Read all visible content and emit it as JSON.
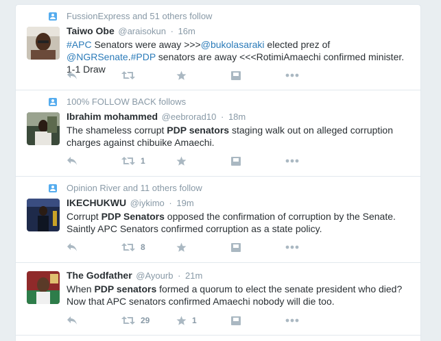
{
  "tweets": [
    {
      "context": "FussionExpress and 51 others follow",
      "fullname": "Taiwo Obe",
      "username": "@araisokun",
      "time": "16m",
      "text_parts": [
        {
          "t": "#APC",
          "k": "hash"
        },
        {
          "t": " Senators were away >>>",
          "k": "plain"
        },
        {
          "t": "@bukolasaraki",
          "k": "link"
        },
        {
          "t": " elected prez of ",
          "k": "plain"
        },
        {
          "t": "@NGRSenate",
          "k": "link"
        },
        {
          "t": ".",
          "k": "plain"
        },
        {
          "t": "#PDP",
          "k": "hash"
        },
        {
          "t": " senators are away <<<RotimiAmaechi confirmed minister. 1-1 Draw",
          "k": "plain"
        }
      ],
      "retweets": "",
      "favorites": ""
    },
    {
      "context": "100% FOLLOW BACK follows",
      "fullname": "Ibrahim mohammed",
      "username": "@eebrorad10",
      "time": "18m",
      "text_parts": [
        {
          "t": "The shameless corrupt ",
          "k": "plain"
        },
        {
          "t": "PDP senators",
          "k": "bold"
        },
        {
          "t": " staging walk out on alleged corruption charges against chibuike Amaechi.",
          "k": "plain"
        }
      ],
      "retweets": "1",
      "favorites": ""
    },
    {
      "context": "Opinion River and 11 others follow",
      "fullname": "IKECHUKWU",
      "username": "@iykimo",
      "time": "19m",
      "text_parts": [
        {
          "t": "Corrupt ",
          "k": "plain"
        },
        {
          "t": "PDP Senators",
          "k": "bold"
        },
        {
          "t": " opposed the confirmation of corruption by the Senate. Saintly APC Senators confirmed corruption as a state policy.",
          "k": "plain"
        }
      ],
      "retweets": "8",
      "favorites": ""
    },
    {
      "context": "",
      "fullname": "The Godfather",
      "username": "@Ayourb",
      "time": "21m",
      "text_parts": [
        {
          "t": "When ",
          "k": "plain"
        },
        {
          "t": "PDP senators",
          "k": "bold"
        },
        {
          "t": " formed a quorum to elect the senate president who died? Now that APC senators confirmed Amaechi nobody will die too.",
          "k": "plain"
        }
      ],
      "retweets": "29",
      "favorites": "1"
    }
  ],
  "separator": "·",
  "icons": [
    "follow-context-icon",
    "reply-icon",
    "retweet-icon",
    "favorite-icon",
    "save-icon",
    "more-icon"
  ],
  "colors": {
    "link": "#2b7bb9",
    "muted": "#8899a6",
    "icon": "#aab8c2",
    "context_icon": "#55acee",
    "background": "#e9eef1"
  }
}
